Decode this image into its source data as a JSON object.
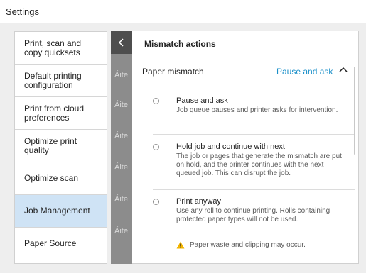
{
  "header": {
    "title": "Settings"
  },
  "sidebar": {
    "items": [
      {
        "label": "Print, scan and\ncopy quicksets"
      },
      {
        "label": "Default printing\nconfiguration"
      },
      {
        "label": "Print from cloud\npreferences"
      },
      {
        "label": "Optimize print\nquality"
      },
      {
        "label": "Optimize scan"
      },
      {
        "label": "Job Management"
      },
      {
        "label": "Paper Source"
      }
    ]
  },
  "midstrip": {
    "ghost_text": [
      "Áite",
      "Áite",
      "Áite",
      "Áite",
      "Áite",
      "Áite"
    ]
  },
  "panel": {
    "title": "Mismatch actions",
    "paper_mismatch": {
      "label": "Paper mismatch",
      "value": "Pause and ask"
    },
    "options": [
      {
        "title": "Pause and ask",
        "description": "Job queue pauses and printer asks for intervention."
      },
      {
        "title": "Hold job and continue with next",
        "description": "The job or pages that generate the mismatch are put on hold, and the printer continues with the next queued job. This can disrupt the job."
      },
      {
        "title": "Print anyway",
        "description": "Use any roll to continue printing. Rolls containing protected paper types will not be used."
      }
    ],
    "warning": "Paper waste and clipping may occur."
  },
  "colors": {
    "accent": "#1a8fc9",
    "active_item": "#cfe3f5",
    "warning": "#f2b400"
  }
}
